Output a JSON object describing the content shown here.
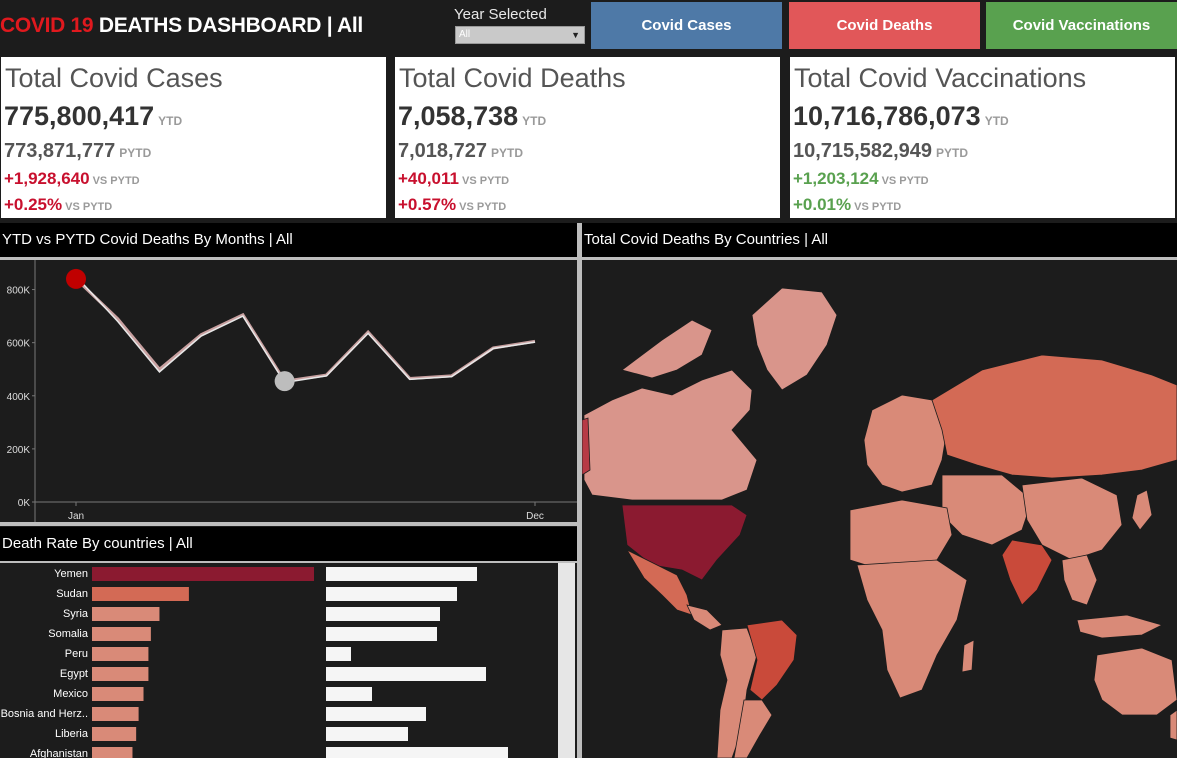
{
  "header": {
    "title_red": "COVID 19",
    "title_rest": " DEATHS DASHBOARD | All",
    "year_label": "Year Selected",
    "year_value": "All",
    "nav": [
      {
        "label": "Covid Cases",
        "color": "#4e79a7"
      },
      {
        "label": "Covid Deaths",
        "color": "#e15759"
      },
      {
        "label": "Covid Vaccinations",
        "color": "#59a14f"
      }
    ]
  },
  "kpis": [
    {
      "title": "Total Covid Cases",
      "ytd": "775,800,417",
      "ytd_tag": "YTD",
      "pytd": "773,871,777",
      "pytd_tag": "PYTD",
      "diff": "+1,928,640",
      "diff_tag": "VS PYTD",
      "pct": "+0.25%",
      "pct_tag": "VS PYTD",
      "accent": "#c8102e"
    },
    {
      "title": "Total Covid Deaths",
      "ytd": "7,058,738",
      "ytd_tag": "YTD",
      "pytd": "7,018,727",
      "pytd_tag": "PYTD",
      "diff": "+40,011",
      "diff_tag": "VS PYTD",
      "pct": "+0.57%",
      "pct_tag": "VS PYTD",
      "accent": "#c8102e"
    },
    {
      "title": "Total Covid Vaccinations",
      "ytd": "10,716,786,073",
      "ytd_tag": "YTD",
      "pytd": "10,715,582,949",
      "pytd_tag": "PYTD",
      "diff": "+1,203,124",
      "diff_tag": "VS PYTD",
      "pct": "+0.01%",
      "pct_tag": "VS PYTD",
      "accent": "#59a14f"
    }
  ],
  "sections": {
    "line_title": "YTD vs PYTD Covid Deaths By Months | All",
    "map_title": "Total Covid Deaths By Countries | All",
    "bars_title": "Death Rate By countries | All"
  },
  "chart_data": [
    {
      "type": "line",
      "x": [
        1,
        2,
        3,
        4,
        5,
        6,
        7,
        8,
        9,
        10,
        11,
        12
      ],
      "xtick_labels": [
        "Jan",
        "Dec"
      ],
      "yticks": [
        "0K",
        "200K",
        "400K",
        "600K",
        "800K"
      ],
      "ylim": [
        0,
        900000
      ],
      "series": [
        {
          "values": [
            840000,
            690000,
            500000,
            630000,
            705000,
            455000,
            478000,
            640000,
            465000,
            475000,
            580000,
            605000
          ],
          "color": "#c8a0a0"
        },
        {
          "values": [
            850000,
            680000,
            490000,
            625000,
            700000,
            450000,
            475000,
            635000,
            462000,
            472000,
            578000,
            602000
          ],
          "color": "#e8e8e8"
        }
      ],
      "highlights": [
        {
          "index": 0,
          "color": "#c00000"
        },
        {
          "index": 5,
          "color": "#bdbdbd"
        }
      ]
    },
    {
      "type": "bar",
      "categories": [
        "Yemen",
        "Sudan",
        "Syria",
        "Somalia",
        "Peru",
        "Egypt",
        "Mexico",
        "Bosnia and Herz..",
        "Liberia",
        "Afghanistan"
      ],
      "values": [
        18.1,
        7.9,
        5.5,
        4.8,
        4.6,
        4.6,
        4.2,
        3.8,
        3.6,
        3.3
      ],
      "colors": [
        "#8b1a30",
        "#d36a55",
        "#d98a78",
        "#d98a78",
        "#d98a78",
        "#d98a78",
        "#d98a78",
        "#d98a78",
        "#d98a78",
        "#d98a78"
      ],
      "secondary_values": [
        151,
        131,
        114,
        111,
        25,
        160,
        46,
        100,
        82,
        182
      ],
      "secondary_color": "#f5f5f5"
    }
  ]
}
